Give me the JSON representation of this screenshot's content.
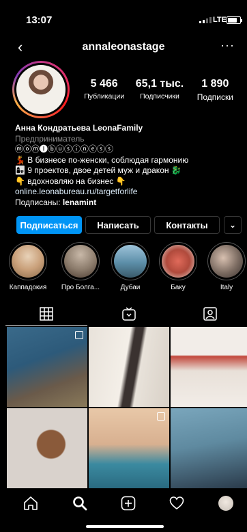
{
  "status": {
    "time": "13:07",
    "network": "LTE"
  },
  "header": {
    "username": "annaleonastage",
    "back_icon": "‹",
    "more_icon": "···"
  },
  "stats": [
    {
      "value": "5 466",
      "label": "Публикации"
    },
    {
      "value": "65,1 тыс.",
      "label": "Подписчики"
    },
    {
      "value": "1 890",
      "label": "Подписки"
    }
  ],
  "bio": {
    "name": "Анна Кондратьева LeonaFamily",
    "category": "Предприниматель",
    "tagline": "ⓜⓞⓜ🅘ⓑⓤⓢⓘⓝⓔⓢⓢ",
    "line1": "💃 В бизнесе по-женски, соблюдая гармонию",
    "line2": "👩‍👧 9 проектов, двое детей муж и дракон 🐉",
    "line3": "👇 вдохновляю на бизнес 👇",
    "link": "online.leonabureau.ru/targetforlife",
    "followed_prefix": "Подписаны:",
    "followed_user": "lenamint"
  },
  "buttons": {
    "follow": "Подписаться",
    "message": "Написать",
    "contacts": "Контакты",
    "dropdown": "⌄"
  },
  "highlights": [
    {
      "label": "Каппадокия",
      "color": "#c9a07a"
    },
    {
      "label": "Про Болга...",
      "color": "#8a7a6a"
    },
    {
      "label": "Дубаи",
      "color": "#5c8ea8"
    },
    {
      "label": "Баку",
      "color": "#b04a3c"
    },
    {
      "label": "Italy",
      "color": "#7a6a60"
    }
  ],
  "tabs": [
    "grid-icon",
    "igtv-icon",
    "tagged-icon"
  ],
  "posts": [
    {
      "desc": "library interior",
      "c1": "#2d5a7a",
      "c2": "#6a5a4a",
      "multi": true
    },
    {
      "desc": "woman white room",
      "c1": "#e8e2da",
      "c2": "#3a3230",
      "multi": false
    },
    {
      "desc": "white red kitchen",
      "c1": "#f2ede8",
      "c2": "#c2483c",
      "multi": false
    },
    {
      "desc": "woman chair",
      "c1": "#d9d2cc",
      "c2": "#8a5a3a",
      "multi": false
    },
    {
      "desc": "boy with toy",
      "c1": "#d8b090",
      "c2": "#3b8aa0",
      "multi": true
    },
    {
      "desc": "blue pool",
      "c1": "#5f8aa0",
      "c2": "#2a3a4a",
      "multi": false
    }
  ],
  "bottom_nav": [
    "home-icon",
    "search-icon",
    "new-post-icon",
    "activity-icon",
    "profile-icon"
  ]
}
